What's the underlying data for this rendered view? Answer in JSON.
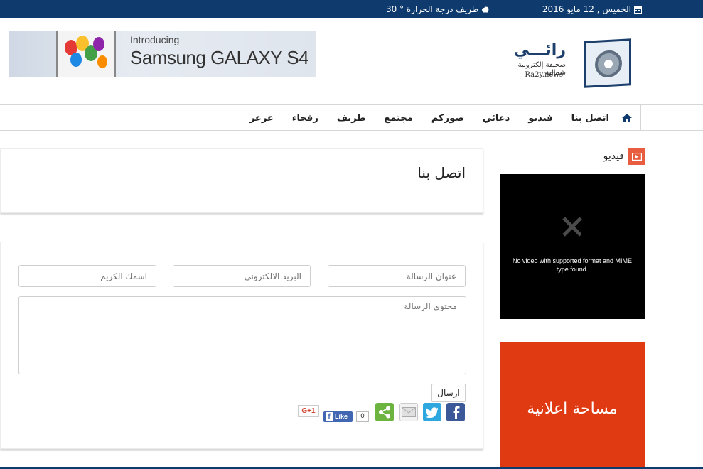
{
  "topbar": {
    "date": "الخميس , 12 مايو 2016",
    "weather": "طريف درجة الحرارة ° 30"
  },
  "logo": {
    "brand": "رائـــي",
    "tagline": "صحيفة إلكترونية شمالية",
    "domain": "Ra2y.news"
  },
  "banner": {
    "intro": "Introducing",
    "product": "Samsung GALAXY S4"
  },
  "nav": {
    "items": [
      "عرعر",
      "رفحاء",
      "طريف",
      "مجتمع",
      "صوركم",
      "دعائي",
      "فيديو",
      "اتصل بنا"
    ]
  },
  "page": {
    "title": "اتصل بنا"
  },
  "form": {
    "subject_placeholder": "عنوان الرسالة",
    "email_placeholder": "البريد الالكتروني",
    "name_placeholder": "اسمك الكريم",
    "body_placeholder": "محتوى الرسالة",
    "send_label": "ارسال"
  },
  "share": {
    "like_label": "Like",
    "like_count": "0",
    "gplus_label": "G+1"
  },
  "sidebar": {
    "video_heading": "فيديو",
    "video_error": "No video with supported format and MIME type found.",
    "ad_text": "مساحة اعلانية"
  },
  "colors": {
    "topbar": "#0e3a6e",
    "accent": "#e85d3f",
    "ad": "#e03a12"
  }
}
